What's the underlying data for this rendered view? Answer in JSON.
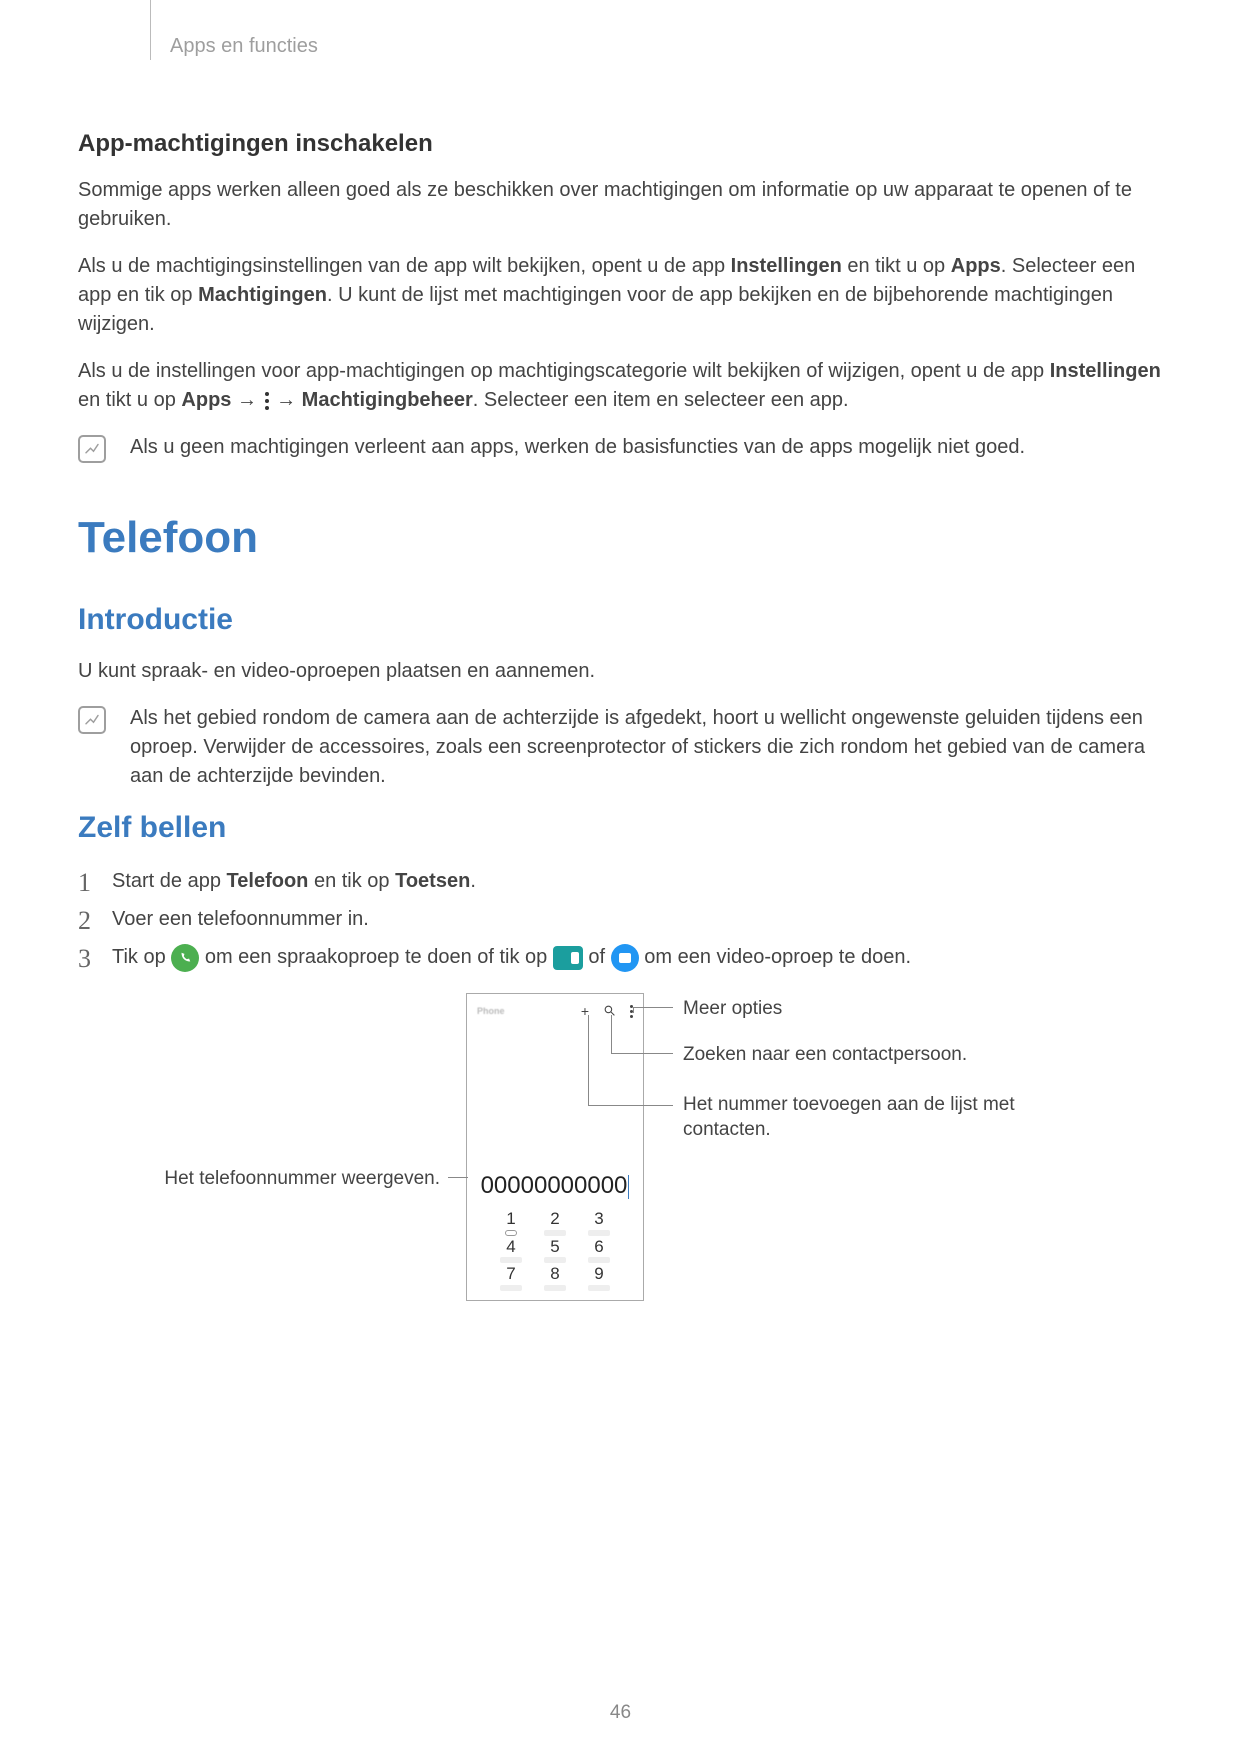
{
  "header": {
    "breadcrumb": "Apps en functies"
  },
  "sec1": {
    "title": "App-machtigingen inschakelen",
    "p1": "Sommige apps werken alleen goed als ze beschikken over machtigingen om informatie op uw apparaat te openen of te gebruiken.",
    "p2a": "Als u de machtigingsinstellingen van de app wilt bekijken, opent u de app ",
    "p2b": "Instellingen",
    "p2c": " en tikt u op ",
    "p2d": "Apps",
    "p2e": ". Selecteer een app en tik op ",
    "p2f": "Machtigingen",
    "p2g": ". U kunt de lijst met machtigingen voor de app bekijken en de bijbehorende machtigingen wijzigen.",
    "p3a": "Als u de instellingen voor app-machtigingen op machtigingscategorie wilt bekijken of wijzigen, opent u de app ",
    "p3b": "Instellingen",
    "p3c": " en tikt u op ",
    "p3d": "Apps",
    "p3e": " → ",
    "p3f": " → ",
    "p3g": "Machtigingbeheer",
    "p3h": ". Selecteer een item en selecteer een app.",
    "note": "Als u geen machtigingen verleent aan apps, werken de basisfuncties van de apps mogelijk niet goed."
  },
  "sec2": {
    "title": "Telefoon",
    "sub1": "Introductie",
    "intro": "U kunt spraak- en video-oproepen plaatsen en aannemen.",
    "note": "Als het gebied rondom de camera aan de achterzijde is afgedekt, hoort u wellicht ongewenste geluiden tijdens een oproep. Verwijder de accessoires, zoals een screenprotector of stickers die zich rondom het gebied van de camera aan de achterzijde bevinden.",
    "sub2": "Zelf bellen",
    "step1a": "Start de app ",
    "step1b": "Telefoon",
    "step1c": " en tik op ",
    "step1d": "Toetsen",
    "step1e": ".",
    "step2": "Voer een telefoonnummer in.",
    "step3a": "Tik op ",
    "step3b": " om een spraakoproep te doen of tik op ",
    "step3c": " of ",
    "step3d": " om een video-oproep te doen."
  },
  "mock": {
    "phone_label": "Phone",
    "number": "00000000000",
    "keys": [
      "1",
      "2",
      "3",
      "4",
      "5",
      "6",
      "7",
      "8",
      "9"
    ]
  },
  "callouts": {
    "c1": "Meer opties",
    "c2": "Zoeken naar een contactpersoon.",
    "c3": "Het nummer toevoegen aan de lijst met contacten.",
    "c4": "Het telefoonnummer weergeven."
  },
  "page_number": "46"
}
